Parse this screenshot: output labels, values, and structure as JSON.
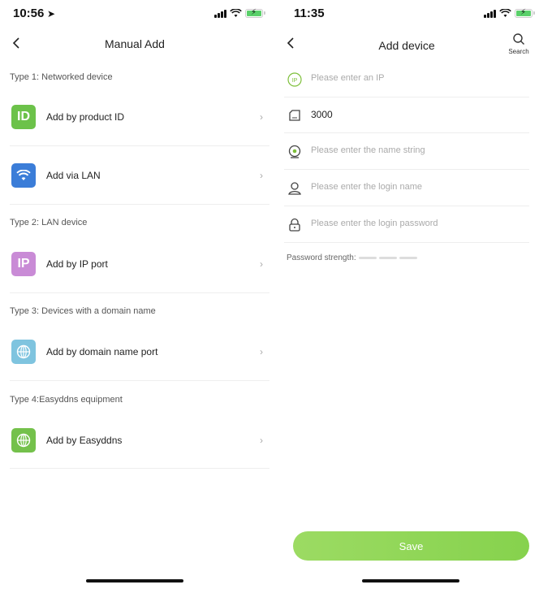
{
  "left": {
    "status": {
      "time": "10:56",
      "arrow_icon": "location-arrow-icon"
    },
    "title": "Manual Add",
    "sections": [
      {
        "label": "Type 1: Networked device"
      },
      {
        "label": "Type 2: LAN device"
      },
      {
        "label": "Type 3: Devices with a domain name"
      },
      {
        "label": "Type 4:Easyddns equipment"
      }
    ],
    "items": [
      {
        "label": "Add by product ID",
        "icon": "id-icon",
        "color": "#6cc24a"
      },
      {
        "label": "Add via LAN",
        "icon": "wifi-icon",
        "color": "#3b7dd8"
      },
      {
        "label": "Add by IP port",
        "icon": "ip-icon",
        "color": "#c98bd6"
      },
      {
        "label": "Add by domain name port",
        "icon": "globe-icon",
        "color": "#7fc4df"
      },
      {
        "label": "Add by Easyddns",
        "icon": "globe-icon",
        "color": "#74c14b"
      }
    ]
  },
  "right": {
    "status": {
      "time": "11:35"
    },
    "title": "Add device",
    "search_label": "Search",
    "fields": [
      {
        "placeholder": "Please enter an IP",
        "value": "",
        "icon": "ip-circle-icon"
      },
      {
        "placeholder": "",
        "value": "3000",
        "icon": "port-icon"
      },
      {
        "placeholder": "Please enter the name string",
        "value": "",
        "icon": "camera-icon"
      },
      {
        "placeholder": "Please enter the login name",
        "value": "",
        "icon": "user-icon"
      },
      {
        "placeholder": "Please enter the login password",
        "value": "",
        "icon": "lock-icon"
      }
    ],
    "password_strength_label": "Password strength:",
    "save_label": "Save"
  },
  "colors": {
    "accent_green": "#8ed655",
    "divider": "#eeeeee"
  }
}
